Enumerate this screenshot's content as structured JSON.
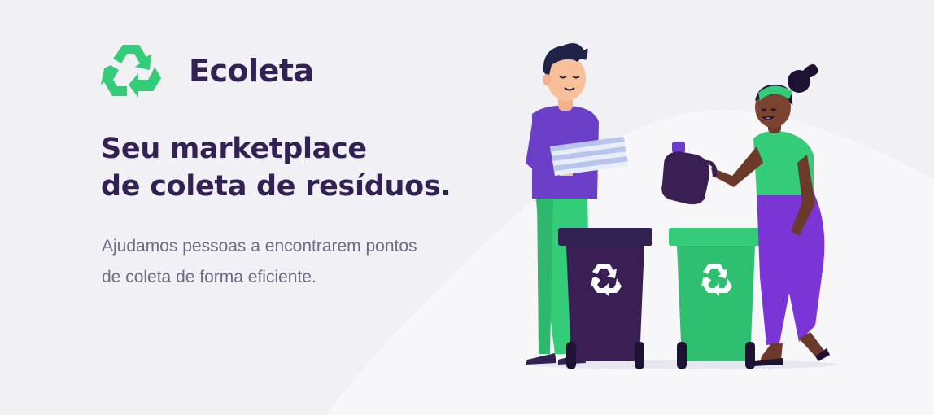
{
  "brand": {
    "name": "Ecoleta",
    "icon": "recycle-icon"
  },
  "hero": {
    "title_line1": "Seu marketplace",
    "title_line2": "de coleta de resíduos.",
    "description_line1": "Ajudamos pessoas a encontrarem pontos",
    "description_line2": "de coleta de forma eficiente."
  },
  "illustration": {
    "description": "",
    "bin_icons": [
      "recycle-icon",
      "recycle-icon"
    ]
  },
  "colors": {
    "background": "#F0F0F5",
    "title": "#322153",
    "text": "#6C6C80",
    "brand_green": "#34CB79",
    "purple": "#6C3FC9",
    "dark_purple": "#3A1F55"
  }
}
